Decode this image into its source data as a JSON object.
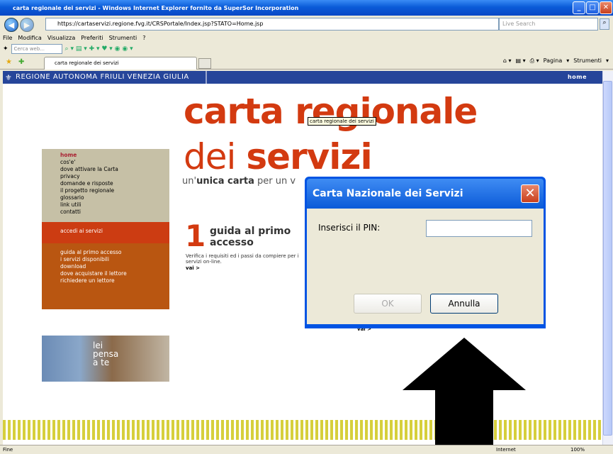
{
  "window": {
    "title": "carta regionale dei servizi - Windows Internet Explorer fornito da SuperSor Incorporation"
  },
  "address": {
    "url": "https://cartaservizi.regione.fvg.it/CRSPortale/Index.jsp?STATO=Home.jsp",
    "search_placeholder": "Live Search"
  },
  "menu": [
    "File",
    "Modifica",
    "Visualizza",
    "Preferiti",
    "Strumenti",
    "?"
  ],
  "toolbar": {
    "search_placeholder": "Cerca web..."
  },
  "tab": {
    "label": "carta regionale dei servizi"
  },
  "cmdbar": {
    "page": "Pagina",
    "tools": "Strumenti"
  },
  "site": {
    "banner": "REGIONE AUTONOMA FRIULI VENEZIA GIULIA",
    "home_link": "home",
    "title_line1": "carta regionale",
    "title_line2a": "dei",
    "title_line2b": "servizi",
    "tooltip": "carta regionale dei servizi",
    "subline_a": "un'",
    "subline_b": "unica carta",
    "subline_c": " per un v",
    "menu1": [
      "home",
      "cos'e'",
      "dove attivare la Carta",
      "privacy",
      "domande e risposte",
      "il progetto regionale",
      "glossario",
      "link utili",
      "contatti"
    ],
    "menu2": "accedi ai servizi",
    "menu3": [
      "guida al primo accesso",
      "i servizi disponibili",
      "download",
      "dove acquistare il lettore",
      "richiedere un lettore"
    ],
    "promo": [
      "lei",
      "pensa",
      "a te"
    ],
    "guide_num": "1",
    "guide_title": "guida al primo accesso",
    "guide_desc": "Verifica i requisiti ed i passi da compiere per i servizi on-line.",
    "vai": "vai >"
  },
  "dialog": {
    "title": "Carta Nazionale dei Servizi",
    "pin_label": "Inserisci il PIN:",
    "ok": "OK",
    "cancel": "Annulla"
  },
  "status": {
    "left": "Fine",
    "zone": "Internet",
    "zoom": "100%"
  }
}
